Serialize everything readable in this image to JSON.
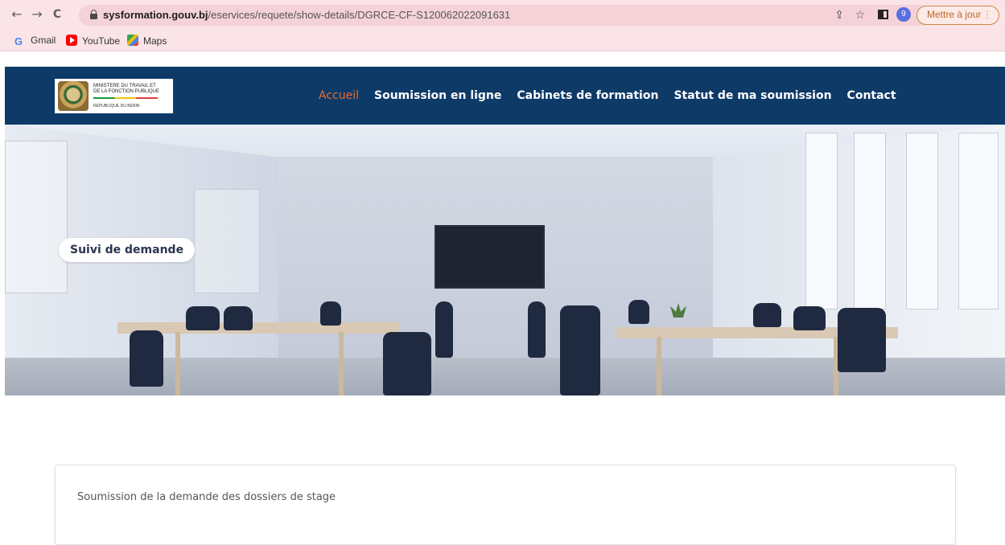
{
  "browser": {
    "url_domain": "sysformation.gouv.bj",
    "url_path": "/eservices/requete/show-details/DGRCE-CF-S120062022091631",
    "profile_initial": "9",
    "update_label": "Mettre à jour",
    "update_dots": "⋮",
    "icons": {
      "back": "←",
      "forward": "→",
      "reload": "C",
      "share": "⇪",
      "star": "☆"
    },
    "bookmarks": [
      {
        "label": "Gmail",
        "icon": "G"
      },
      {
        "label": "YouTube",
        "icon": "youtube-icon"
      },
      {
        "label": "Maps",
        "icon": "maps-icon"
      }
    ]
  },
  "site": {
    "logo": {
      "line1": "MINISTERE DU TRAVAIL ET",
      "line2": "DE LA FONCTION PUBLIQUE",
      "line3": "REPUBLIQUE DU BENIN"
    },
    "nav": [
      {
        "label": "Accueil",
        "active": true
      },
      {
        "label": "Soumission en ligne",
        "active": false
      },
      {
        "label": "Cabinets de formation",
        "active": false
      },
      {
        "label": "Statut de ma soumission",
        "active": false
      },
      {
        "label": "Contact",
        "active": false
      }
    ],
    "hero_badge": "Suivi de demande",
    "card_title": "Soumission de la demande des dossiers de stage",
    "colors": {
      "header_bg": "#0e3a68",
      "nav_active": "#f06a2a",
      "browser_bg": "#fbe4e8"
    }
  }
}
